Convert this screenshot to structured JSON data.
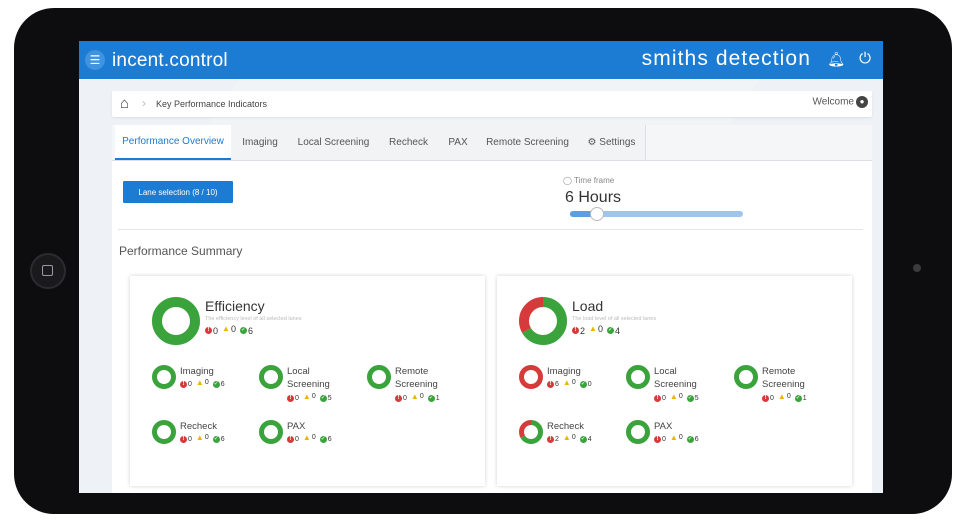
{
  "header": {
    "app_title": "incent.control",
    "brand": "smiths detection"
  },
  "breadcrumb": {
    "current": "Key Performance Indicators",
    "welcome": "Welcome"
  },
  "tabs": [
    {
      "label": "Performance Overview",
      "active": true
    },
    {
      "label": "Imaging"
    },
    {
      "label": "Local Screening"
    },
    {
      "label": "Recheck"
    },
    {
      "label": "PAX"
    },
    {
      "label": "Remote Screening"
    },
    {
      "label": "Settings",
      "icon": "gears-icon"
    }
  ],
  "controls": {
    "lane_selection": "Lane selection (8 / 10)",
    "timeframe_label": "Time frame",
    "timeframe_value": "6 Hours",
    "slider_level": 0.15
  },
  "summary_title": "Performance Summary",
  "cards": [
    {
      "title": "Efficiency",
      "subtitle": "The efficiency level of all selected lanes",
      "stats": {
        "red": "0",
        "warn": "0",
        "green": "6"
      },
      "items": [
        {
          "label1": "Imaging",
          "label2": "",
          "red": "0",
          "warn": "0",
          "green": "6"
        },
        {
          "label1": "Local",
          "label2": "Screening",
          "red": "0",
          "warn": "0",
          "green": "5"
        },
        {
          "label1": "Remote",
          "label2": "Screening",
          "red": "0",
          "warn": "0",
          "green": "1"
        },
        {
          "label1": "Recheck",
          "label2": "",
          "red": "0",
          "warn": "0",
          "green": "6"
        },
        {
          "label1": "PAX",
          "label2": "",
          "red": "0",
          "warn": "0",
          "green": "6"
        }
      ]
    },
    {
      "title": "Load",
      "subtitle": "The load level of all selected lanes",
      "stats": {
        "red": "2",
        "warn": "0",
        "green": "4"
      },
      "items": [
        {
          "label1": "Imaging",
          "label2": "",
          "red": "6",
          "warn": "0",
          "green": "0"
        },
        {
          "label1": "Local",
          "label2": "Screening",
          "red": "0",
          "warn": "0",
          "green": "5"
        },
        {
          "label1": "Remote",
          "label2": "Screening",
          "red": "0",
          "warn": "0",
          "green": "1"
        },
        {
          "label1": "Recheck",
          "label2": "",
          "red": "2",
          "warn": "0",
          "green": "4"
        },
        {
          "label1": "PAX",
          "label2": "",
          "red": "0",
          "warn": "0",
          "green": "6"
        }
      ]
    }
  ],
  "colors": {
    "accent": "#1c7bd3",
    "ok": "#3aa33c",
    "alert": "#d63a3a",
    "warn": "#f0b400"
  }
}
